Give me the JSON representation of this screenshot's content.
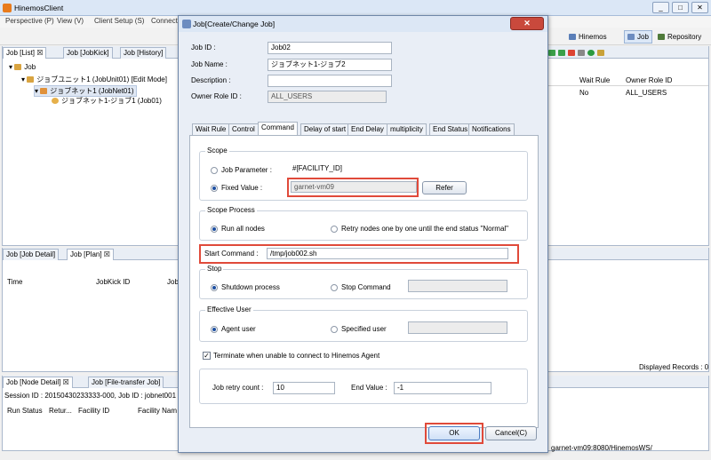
{
  "app": {
    "title": "HinemosClient",
    "window_controls": [
      "_",
      "□",
      "✕"
    ]
  },
  "menu": [
    "Perspective (P)",
    "View (V)",
    "Client Setup (S)",
    "Connect"
  ],
  "perspectives": [
    "Hinemos",
    "Job",
    "Repository"
  ],
  "job_list_panel": {
    "tabs": [
      "Job [List]",
      "Job [JobKick]",
      "Job [History]"
    ],
    "tree": [
      "Job",
      "ジョブユニット1 (JobUnit01) [Edit Mode]",
      "ジョブネット1 (JobNet01)",
      "ジョブネット1-ジョブ1 (Job01)"
    ]
  },
  "right_table": {
    "headers": [
      "Wait Rule",
      "Owner Role ID"
    ],
    "row": [
      "No",
      "ALL_USERS"
    ],
    "footer": "Displayed Records : 0"
  },
  "job_plan_panel": {
    "tabs": [
      "Job [Job Detail]",
      "Job [Plan]"
    ],
    "headers": [
      "Time",
      "JobKick ID",
      "Job"
    ]
  },
  "node_panel": {
    "tabs": [
      "Job [Node Detail]",
      "Job [File-transfer Job]"
    ],
    "session": "Session ID : 20150430233333-000,  Job ID : jobnet001",
    "headers": [
      "Run Status",
      "Retur...",
      "Facility ID",
      "Facility Nam"
    ]
  },
  "statusbar": {
    "url": "garnet-vm09:8080/HinemosWS/"
  },
  "dialog": {
    "title": "Job[Create/Change Job]",
    "close_symbol": "✕",
    "job_id": {
      "label": "Job ID :",
      "value": "Job02"
    },
    "job_name": {
      "label": "Job Name :",
      "value": "ジョブネット1-ジョブ2"
    },
    "description": {
      "label": "Description :",
      "value": ""
    },
    "owner_role": {
      "label": "Owner Role ID :",
      "value": "ALL_USERS"
    },
    "tabs": [
      "Wait Rule",
      "Control",
      "Command",
      "Delay of start",
      "End Delay",
      "multiplicity",
      "End Status",
      "Notifications"
    ],
    "scope": {
      "title": "Scope",
      "job_param_label": "Job Parameter :",
      "job_param_value": "#[FACILITY_ID]",
      "fixed_label": "Fixed Value :",
      "fixed_value": "garnet-vm09",
      "refer_label": "Refer"
    },
    "scope_process": {
      "title": "Scope Process",
      "opt1": "Run all nodes",
      "opt2": "Retry nodes one by one until the end status \"Normal\""
    },
    "start_command": {
      "label": "Start Command :",
      "value": "/tmp/job002.sh"
    },
    "stop": {
      "title": "Stop",
      "opt1": "Shutdown process",
      "opt2": "Stop Command",
      "value": ""
    },
    "effective_user": {
      "title": "Effective User",
      "opt1": "Agent user",
      "opt2": "Specified user",
      "value": ""
    },
    "terminate_label": "Terminate when unable to connect to Hinemos Agent",
    "retry": {
      "count_label": "Job retry count :",
      "count_value": "10",
      "end_label": "End Value :",
      "end_value": "-1"
    },
    "ok_label": "OK",
    "cancel_label": "Cancel(C)"
  },
  "colors": {
    "highlight": "#e04a3a",
    "accent": "#1c4ea0"
  }
}
